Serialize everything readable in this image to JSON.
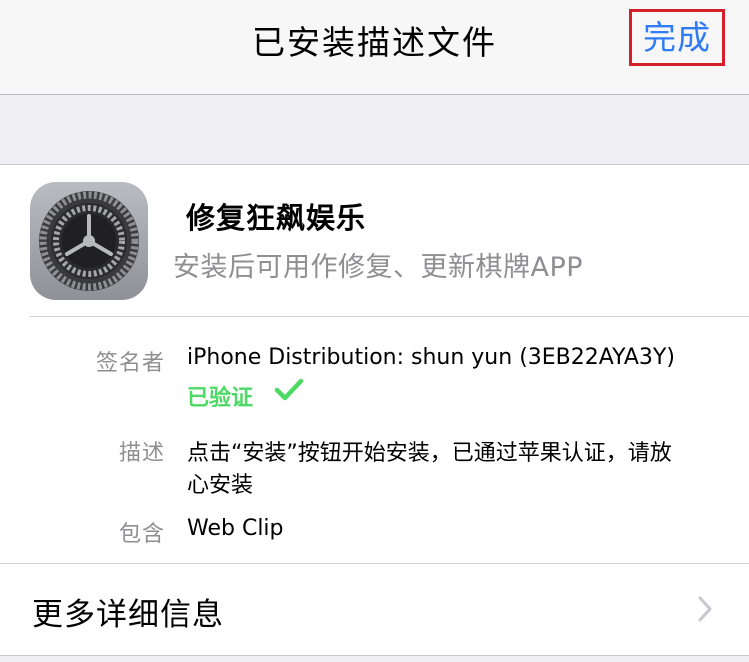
{
  "navbar": {
    "title": "已安装描述文件",
    "done_label": "完成"
  },
  "profile": {
    "name": "修复狂飙娱乐",
    "subtitle": "安装后可用作修复、更新棋牌APP",
    "icon": "settings-gear-icon"
  },
  "details": {
    "signer_label": "签名者",
    "signer_value": "iPhone Distribution: shun yun (3EB22AYA3Y)",
    "verified_label": "已验证",
    "description_label": "描述",
    "description_line1": "点击“安装”按钮开始安装，已通过苹果认证，请放",
    "description_line2": "心安装",
    "contains_label": "包含",
    "contains_value": "Web Clip"
  },
  "more_info": {
    "label": "更多详细信息"
  },
  "colors": {
    "accent": "#2f7cf6",
    "verified": "#4cd964",
    "highlight_border": "#d3202a"
  }
}
